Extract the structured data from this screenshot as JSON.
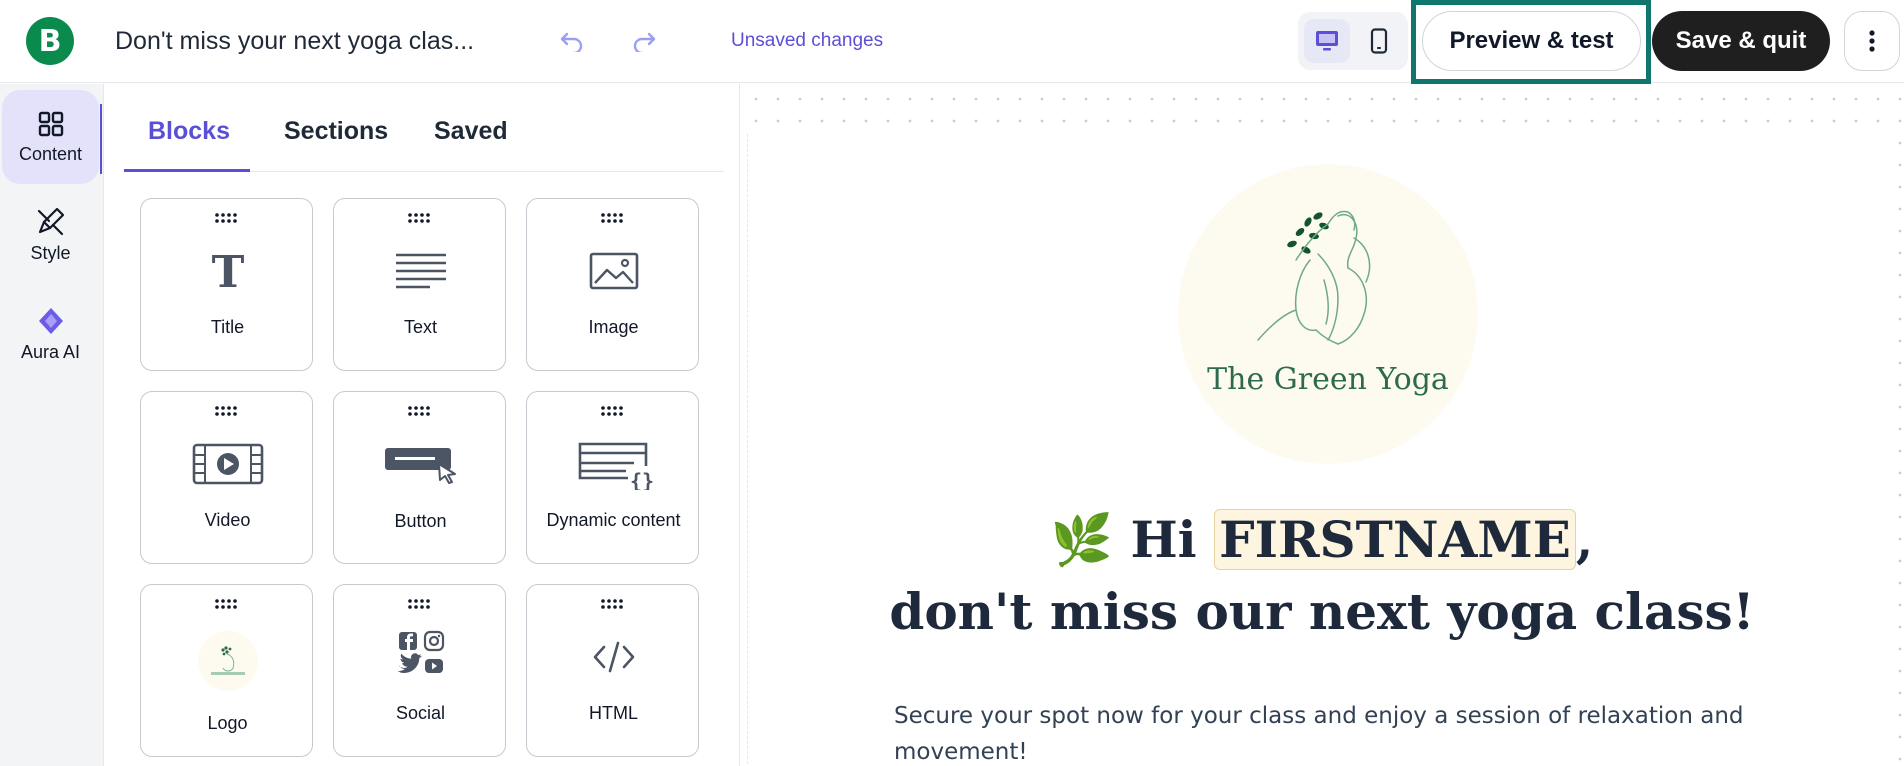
{
  "header": {
    "brand_letter": "B",
    "campaign_title": "Don't miss your next yoga clas...",
    "unsaved_label": "Unsaved changes",
    "preview_label": "Preview & test",
    "save_label": "Save & quit",
    "device_selected": "desktop"
  },
  "rail": {
    "items": [
      {
        "label": "Content",
        "icon": "grid-icon",
        "active": true
      },
      {
        "label": "Style",
        "icon": "pen-icon",
        "active": false
      },
      {
        "label": "Aura AI",
        "icon": "sparkle-icon",
        "active": false
      }
    ]
  },
  "panel": {
    "tabs": [
      {
        "label": "Blocks",
        "active": true
      },
      {
        "label": "Sections",
        "active": false
      },
      {
        "label": "Saved",
        "active": false
      }
    ],
    "blocks": [
      {
        "label": "Title",
        "icon": "title-icon"
      },
      {
        "label": "Text",
        "icon": "text-icon"
      },
      {
        "label": "Image",
        "icon": "image-icon"
      },
      {
        "label": "Video",
        "icon": "video-icon"
      },
      {
        "label": "Button",
        "icon": "button-icon"
      },
      {
        "label": "Dynamic content",
        "icon": "dynamic-content-icon"
      },
      {
        "label": "Logo",
        "icon": "logo-thumbnail-icon"
      },
      {
        "label": "Social",
        "icon": "social-icons"
      },
      {
        "label": "HTML",
        "icon": "html-icon"
      }
    ]
  },
  "email": {
    "logo_text": "The Green Yoga",
    "greeting_emoji": "🌿",
    "greeting_prefix": "Hi",
    "firstname_tag": "FIRSTNAME",
    "greeting_suffix": ",",
    "headline_line2": "don't miss our next yoga class!",
    "body": "Secure your spot now for your class and enjoy a session of relaxation and movement!"
  },
  "colors": {
    "accent": "#5b4fd6",
    "brand_green": "#0b8a4e",
    "highlight_border": "#0f766e",
    "save_button": "#1f1f1f",
    "logo_green": "#2d6a4f"
  }
}
